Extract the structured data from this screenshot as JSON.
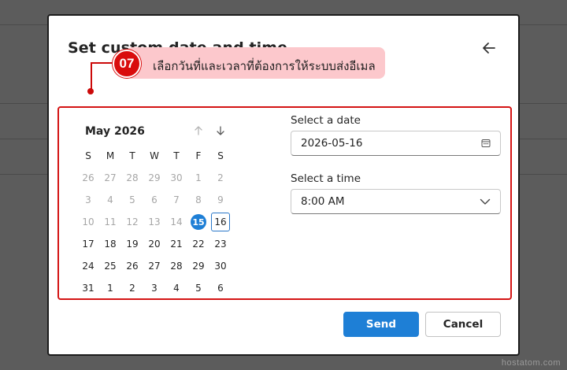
{
  "dialog": {
    "title": "Set custom date and time",
    "back_icon": "arrow-left-icon"
  },
  "annotation": {
    "step": "07",
    "text": "เลือกวันที่และเวลาที่ต้องการให้ระบบส่งอีเมล"
  },
  "calendar": {
    "month_label": "May 2026",
    "prev_icon": "arrow-up-icon",
    "next_icon": "arrow-down-icon",
    "weekdays": [
      "S",
      "M",
      "T",
      "W",
      "T",
      "F",
      "S"
    ],
    "weeks": [
      [
        "26",
        "27",
        "28",
        "29",
        "30",
        "1",
        "2"
      ],
      [
        "3",
        "4",
        "5",
        "6",
        "7",
        "8",
        "9"
      ],
      [
        "10",
        "11",
        "12",
        "13",
        "14",
        "15",
        "16"
      ],
      [
        "17",
        "18",
        "19",
        "20",
        "21",
        "22",
        "23"
      ],
      [
        "24",
        "25",
        "26",
        "27",
        "28",
        "29",
        "30"
      ],
      [
        "31",
        "1",
        "2",
        "3",
        "4",
        "5",
        "6"
      ]
    ],
    "today": "15",
    "selected": "16"
  },
  "date_field": {
    "label": "Select a date",
    "value": "2026-05-16",
    "icon": "calendar-icon"
  },
  "time_field": {
    "label": "Select a time",
    "value": "8:00 AM",
    "icon": "chevron-down-icon"
  },
  "actions": {
    "send_label": "Send",
    "cancel_label": "Cancel"
  },
  "colors": {
    "accent": "#1e7fd6",
    "annotation_red": "#d90d0d",
    "annotation_pill": "#fcc8cc"
  },
  "watermark": "hostatom.com"
}
